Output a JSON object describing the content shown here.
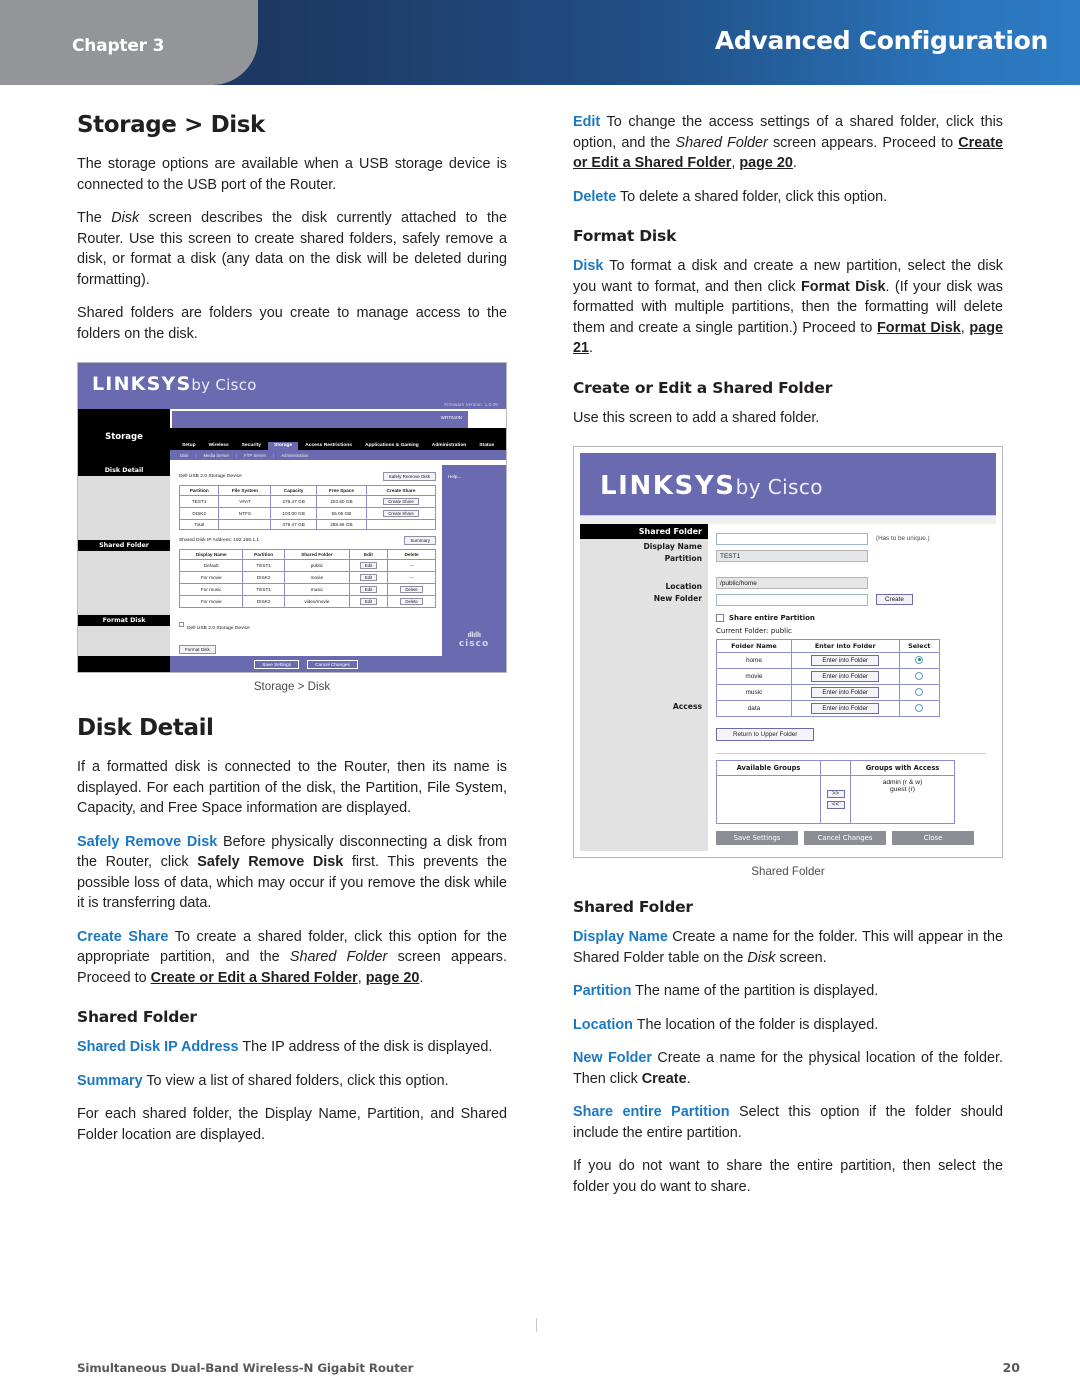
{
  "header": {
    "chapter_label": "Chapter 3",
    "title": "Advanced Configuration",
    "gradient_start": "#1d3461",
    "gradient_end": "#2d7cc4",
    "tab_color": "#939598"
  },
  "accent_color": "#1b78c2",
  "left_column": {
    "heading": "Storage > Disk",
    "paragraphs": [
      "The storage options are available when a USB storage device is connected to the USB port of the Router.",
      "The Disk screen describes the disk currently attached to the Router. Use this screen to create shared folders, safely remove a disk, or format a disk (any data on the disk will be deleted during formatting).",
      "Shared folders are folders you create to manage access to the folders on the disk."
    ],
    "figure_caption": "Storage > Disk",
    "disk_detail": {
      "heading": "Disk Detail",
      "intro": "If a formatted disk is connected to the Router, then its name is displayed. For each partition of the disk, the Partition, File System, Capacity, and Free Space information are displayed.",
      "safely_remove_term": "Safely Remove Disk",
      "safely_remove_text_1": " Before physically disconnecting a disk from the Router, click ",
      "safely_remove_bold": "Safely Remove Disk",
      "safely_remove_text_2": " first. This prevents the possible loss of data, which may occur if you remove the disk while it is transferring data.",
      "create_share_term": "Create Share",
      "create_share_text_1": "  To create a shared folder, click this option for the appropriate partition, and the ",
      "create_share_italic": "Shared Folder",
      "create_share_text_2": " screen appears. Proceed to ",
      "create_share_link": "Create or Edit a Shared Folder",
      "create_share_comma": ", ",
      "create_share_page": "page 20",
      "create_share_period": "."
    },
    "shared_folder": {
      "heading": "Shared Folder",
      "ip_term": "Shared Disk IP Address",
      "ip_text": " The IP address of the disk is displayed.",
      "summary_term": "Summary",
      "summary_text": "  To view a list of shared folders, click this option.",
      "closing": "For each shared folder, the Display Name, Partition, and Shared Folder location are displayed."
    }
  },
  "right_column": {
    "edit_term": "Edit",
    "edit_text_1": "  To change the access settings of a shared folder, click this option, and the ",
    "edit_italic": "Shared Folder",
    "edit_text_2": " screen appears. Proceed to ",
    "edit_link": "Create or Edit a Shared Folder",
    "edit_comma": ", ",
    "edit_page": "page 20",
    "edit_period": ".",
    "delete_term": "Delete",
    "delete_text": "  To delete a shared folder, click this option.",
    "format_disk": {
      "heading": "Format Disk",
      "disk_term": "Disk",
      "disk_text_1": "  To format a disk and create a new partition, select the disk you want to format, and then click ",
      "disk_bold": "Format Disk",
      "disk_text_2": ". (If your disk was formatted with multiple partitions, then the formatting will delete them and create a single partition.) Proceed to ",
      "disk_link": "Format Disk",
      "disk_comma": ", ",
      "disk_page": "page 21",
      "disk_period": "."
    },
    "create_or_edit": {
      "heading": "Create or Edit a Shared Folder",
      "intro": "Use this screen to add a shared folder."
    },
    "figure_caption": "Shared Folder",
    "shared_folder": {
      "heading": "Shared Folder",
      "display_name_term": "Display Name",
      "display_name_text_1": " Create a name for the folder. This will appear in the Shared Folder table on the ",
      "display_name_italic": "Disk",
      "display_name_text_2": " screen.",
      "partition_term": "Partition",
      "partition_text": "  The name of the partition is displayed.",
      "location_term": "Location",
      "location_text": "  The location of the folder is displayed.",
      "new_folder_term": "New Folder",
      "new_folder_text_1": "  Create a name for the physical location of the folder. Then click ",
      "new_folder_bold": "Create",
      "new_folder_text_2": ".",
      "share_partition_term": "Share entire Partition",
      "share_partition_text": "  Select this option if the folder should include the entire partition.",
      "closing": "If you do not want to share the entire partition, then select the folder you do want to share."
    }
  },
  "disk_screenshot": {
    "brand": "LINKSYS",
    "brand_suffix": "by Cisco",
    "firmware": "Firmware Version: 1.0.00",
    "model": "WRT610N",
    "section_title": "Storage",
    "tabs": [
      "Setup",
      "Wireless",
      "Security",
      "Storage",
      "Access Restrictions",
      "Applications & Gaming",
      "Administration",
      "Status"
    ],
    "active_tab": "Storage",
    "subtabs": [
      "Disk",
      "Media Server",
      "FTP Server",
      "Administration"
    ],
    "side_blocks": [
      "Disk Detail",
      "Shared Folder",
      "Format Disk"
    ],
    "device_label": "Dell USB 2.0 Storage Device",
    "safely_remove_button": "Safely Remove Disk",
    "disk_table": {
      "headers": [
        "Partition",
        "File System",
        "Capacity",
        "Free Space",
        "Create Share"
      ],
      "rows": [
        [
          "TEST1",
          "VFAT",
          "276.47 GB",
          "203.60 GB",
          "Create Share"
        ],
        [
          "DISK2",
          "NTFS",
          "103.00 GB",
          "55.05 GB",
          "Create Share"
        ],
        [
          "Total",
          "",
          "379.47 GB",
          "258.66 GB",
          ""
        ]
      ]
    },
    "shared_ip_label": "Shared Disk IP Address: 192.168.1.1",
    "summary_button": "Summary",
    "shared_table": {
      "headers": [
        "Display Name",
        "Partition",
        "Shared Folder",
        "Edit",
        "Delete"
      ],
      "rows": [
        [
          "Default",
          "TEST1",
          "public",
          "Edit",
          "---"
        ],
        [
          "For movie",
          "DISK2",
          "movie",
          "Edit",
          "---"
        ],
        [
          "For music",
          "TEST1",
          "music",
          "Edit",
          "Delete"
        ],
        [
          "For movie",
          "DISK2",
          "video/movie",
          "Edit",
          "Delete"
        ]
      ]
    },
    "format_checkbox_label": "Dell USB 2.0 Storage Device",
    "format_button": "Format Disk",
    "help_label": "Help...",
    "save_button": "Save Settings",
    "cancel_button": "Cancel Changes",
    "cisco_logo": "cisco"
  },
  "shared_folder_screenshot": {
    "brand": "LINKSYS",
    "brand_suffix": "by Cisco",
    "side_heading": "Shared Folder",
    "labels": {
      "display_name": "Display Name",
      "partition": "Partition",
      "location": "Location",
      "new_folder": "New Folder",
      "access": "Access"
    },
    "display_name_value": "",
    "display_name_hint": "(Has to be unique.)",
    "partition_value": "TEST1",
    "location_value": "/public/home",
    "new_folder_value": "",
    "create_button": "Create",
    "share_partition_checkbox": "Share entire Partition",
    "current_folder_label": "Current Folder:",
    "current_folder_value": "public",
    "folder_table": {
      "headers": [
        "Folder Name",
        "Enter into Folder",
        "Select"
      ],
      "rows": [
        {
          "name": "home",
          "button": "Enter into Folder",
          "selected": true
        },
        {
          "name": "movie",
          "button": "Enter into Folder",
          "selected": false
        },
        {
          "name": "music",
          "button": "Enter into Folder",
          "selected": false
        },
        {
          "name": "data",
          "button": "Enter into Folder",
          "selected": false
        }
      ]
    },
    "return_button": "Return to Upper Folder",
    "access_table": {
      "headers": [
        "Available Groups",
        "",
        "Groups with Access"
      ],
      "add_button": ">>",
      "remove_button": "<<",
      "available": [],
      "with_access": [
        "admin (r & w)",
        "guest (r)"
      ]
    },
    "footer_buttons": [
      "Save Settings",
      "Cancel Changes",
      "Close"
    ]
  },
  "footer": {
    "product": "Simultaneous Dual-Band Wireless-N Gigabit Router",
    "page_number": "20"
  }
}
